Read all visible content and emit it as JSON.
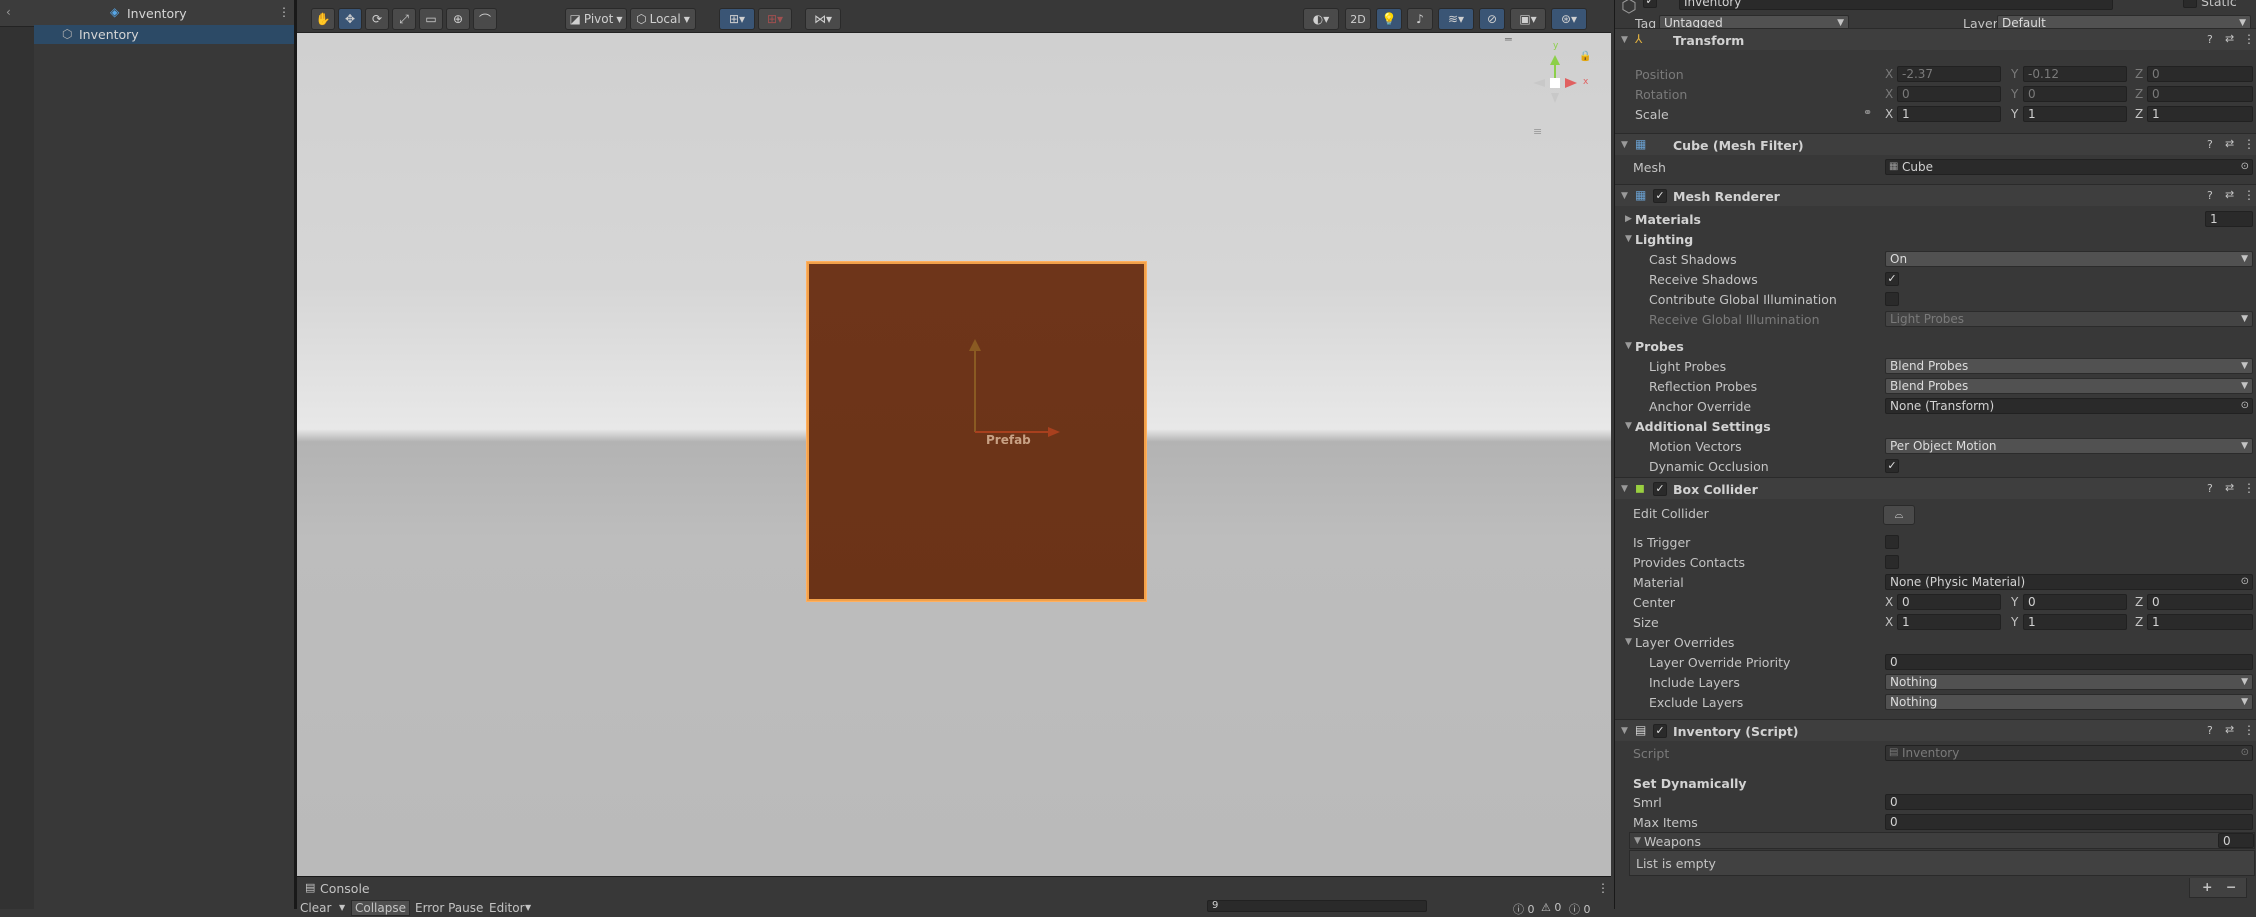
{
  "hierarchy": {
    "root_title": "Inventory",
    "child": "Inventory"
  },
  "toolbar": {
    "pivot": "Pivot",
    "local": "Local",
    "twod": "2D"
  },
  "scene": {
    "prefab_label": "Prefab",
    "gizmo_y": "y",
    "gizmo_x": "x"
  },
  "console": {
    "tab": "Console",
    "clear": "Clear",
    "collapse": "Collapse",
    "error_pause": "Error Pause",
    "editor": "Editor",
    "search_value": "9",
    "count_log": "0",
    "count_warn": "0",
    "count_err": "0"
  },
  "inspector": {
    "object_name": "Inventory",
    "static_label": "Static",
    "tag_label": "Tag",
    "tag_value": "Untagged",
    "layer_label": "Layer",
    "layer_value": "Default",
    "transform": {
      "title": "Transform",
      "position_label": "Position",
      "rotation_label": "Rotation",
      "scale_label": "Scale",
      "position": {
        "x": "-2.37",
        "y": "-0.12",
        "z": "0"
      },
      "rotation": {
        "x": "0",
        "y": "0",
        "z": "0"
      },
      "scale": {
        "x": "1",
        "y": "1",
        "z": "1"
      }
    },
    "mesh_filter": {
      "title": "Cube (Mesh Filter)",
      "mesh_label": "Mesh",
      "mesh_value": "Cube"
    },
    "mesh_renderer": {
      "title": "Mesh Renderer",
      "materials_label": "Materials",
      "materials_count": "1",
      "lighting_label": "Lighting",
      "cast_shadows_label": "Cast Shadows",
      "cast_shadows_value": "On",
      "receive_shadows_label": "Receive Shadows",
      "contribute_gi_label": "Contribute Global Illumination",
      "receive_gi_label": "Receive Global Illumination",
      "receive_gi_value": "Light Probes",
      "probes_label": "Probes",
      "light_probes_label": "Light Probes",
      "light_probes_value": "Blend Probes",
      "reflection_probes_label": "Reflection Probes",
      "reflection_probes_value": "Blend Probes",
      "anchor_override_label": "Anchor Override",
      "anchor_override_value": "None (Transform)",
      "additional_label": "Additional Settings",
      "motion_vectors_label": "Motion Vectors",
      "motion_vectors_value": "Per Object Motion",
      "dynamic_occlusion_label": "Dynamic Occlusion"
    },
    "box_collider": {
      "title": "Box Collider",
      "edit_collider_label": "Edit Collider",
      "is_trigger_label": "Is Trigger",
      "provides_contacts_label": "Provides Contacts",
      "material_label": "Material",
      "material_value": "None (Physic Material)",
      "center_label": "Center",
      "center": {
        "x": "0",
        "y": "0",
        "z": "0"
      },
      "size_label": "Size",
      "size": {
        "x": "1",
        "y": "1",
        "z": "1"
      },
      "layer_overrides_label": "Layer Overrides",
      "layer_override_priority_label": "Layer Override Priority",
      "layer_override_priority_value": "0",
      "include_layers_label": "Include Layers",
      "include_layers_value": "Nothing",
      "exclude_layers_label": "Exclude Layers",
      "exclude_layers_value": "Nothing"
    },
    "script": {
      "title": "Inventory (Script)",
      "script_label": "Script",
      "script_value": "Inventory",
      "set_dynamically_label": "Set Dynamically",
      "smrl_label": "Smrl",
      "smrl_value": "0",
      "max_items_label": "Max Items",
      "max_items_value": "0",
      "weapons_label": "Weapons",
      "weapons_count": "0",
      "list_empty": "List is empty",
      "add_label": "+",
      "remove_label": "−"
    },
    "axes": {
      "x": "X",
      "y": "Y",
      "z": "Z"
    }
  },
  "colors": {
    "cube": "#6e351a",
    "selection_outline": "#f2a14a",
    "hierarchy_selected": "#2c4a66",
    "panel_bg": "#383838"
  }
}
